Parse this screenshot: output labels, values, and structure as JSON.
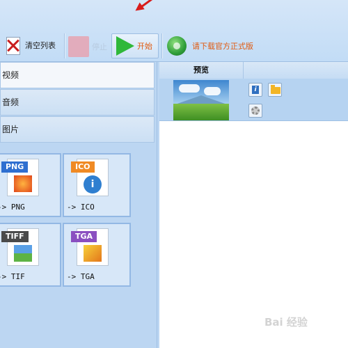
{
  "toolbar": {
    "clear_list": "清空列表",
    "stop": "停止",
    "start": "开始",
    "download": "请下载官方正式版"
  },
  "categories": [
    "视频",
    "音频",
    "图片"
  ],
  "formats": [
    {
      "tag": "PNG",
      "label": "-> PNG",
      "tag_color": "#2f6fd0"
    },
    {
      "tag": "ICO",
      "label": "-> ICO",
      "tag_color": "#f08a24"
    },
    {
      "tag": "TIFF",
      "label": "-> TIF",
      "tag_color": "#4a4a4a"
    },
    {
      "tag": "TGA",
      "label": "-> TGA",
      "tag_color": "#8a4fc0"
    }
  ],
  "grid": {
    "col_preview": "预览"
  },
  "watermark": "Bai 经验",
  "icons": [
    "clear-list-icon",
    "stop-icon",
    "play-icon",
    "download-globe-icon",
    "info-icon",
    "folder-icon",
    "settings-gear-icon"
  ],
  "colors": {
    "start_text": "#e05a10",
    "download_text": "#e05a10",
    "play_green": "#2fb83a",
    "annotation_arrow": "#d81c1c"
  }
}
